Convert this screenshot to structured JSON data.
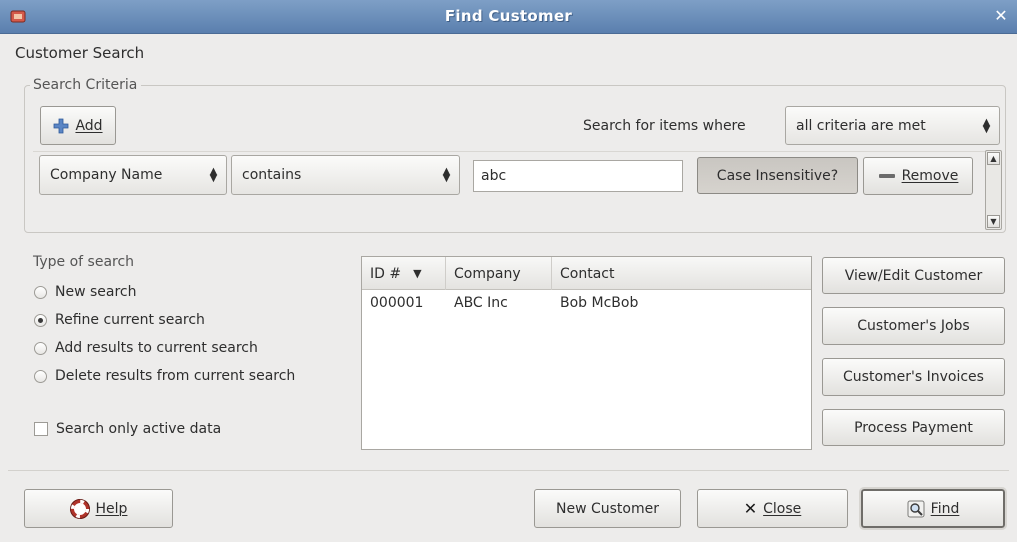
{
  "window": {
    "title": "Find Customer",
    "close_glyph": "✕",
    "app_icon": "gnucash-app-icon"
  },
  "heading": "Customer Search",
  "search_criteria": {
    "group_label": "Search Criteria",
    "add_label": "Add",
    "search_for_label": "Search for items where",
    "match_select": {
      "value": "all criteria are met"
    },
    "criteria_row": {
      "field_select": {
        "value": "Company Name"
      },
      "operator_select": {
        "value": "contains"
      },
      "value_input": {
        "value": "abc"
      },
      "case_label": "Case Insensitive?",
      "remove_label": "Remove"
    }
  },
  "type_of_search": {
    "group_label": "Type of search",
    "options": [
      {
        "label": "New search",
        "checked": false
      },
      {
        "label": "Refine current search",
        "checked": true
      },
      {
        "label": "Add results to current search",
        "checked": false
      },
      {
        "label": "Delete results from current search",
        "checked": false
      }
    ],
    "active_only_label": "Search only active data"
  },
  "results": {
    "columns": [
      "ID #",
      "Company",
      "Contact"
    ],
    "rows": [
      {
        "id": "000001",
        "company": "ABC Inc",
        "contact": "Bob McBob"
      }
    ]
  },
  "actions": {
    "view_edit": "View/Edit Customer",
    "jobs": "Customer's Jobs",
    "invoices": "Customer's Invoices",
    "payment": "Process Payment"
  },
  "footer": {
    "help": "Help",
    "new_customer": "New Customer",
    "close": "Close",
    "find": "Find"
  },
  "colors": {
    "titlebar": "#6a8db9",
    "window_bg": "#edeceb",
    "add_icon": "#5b86c5",
    "close_x": "#1a1a1a"
  }
}
